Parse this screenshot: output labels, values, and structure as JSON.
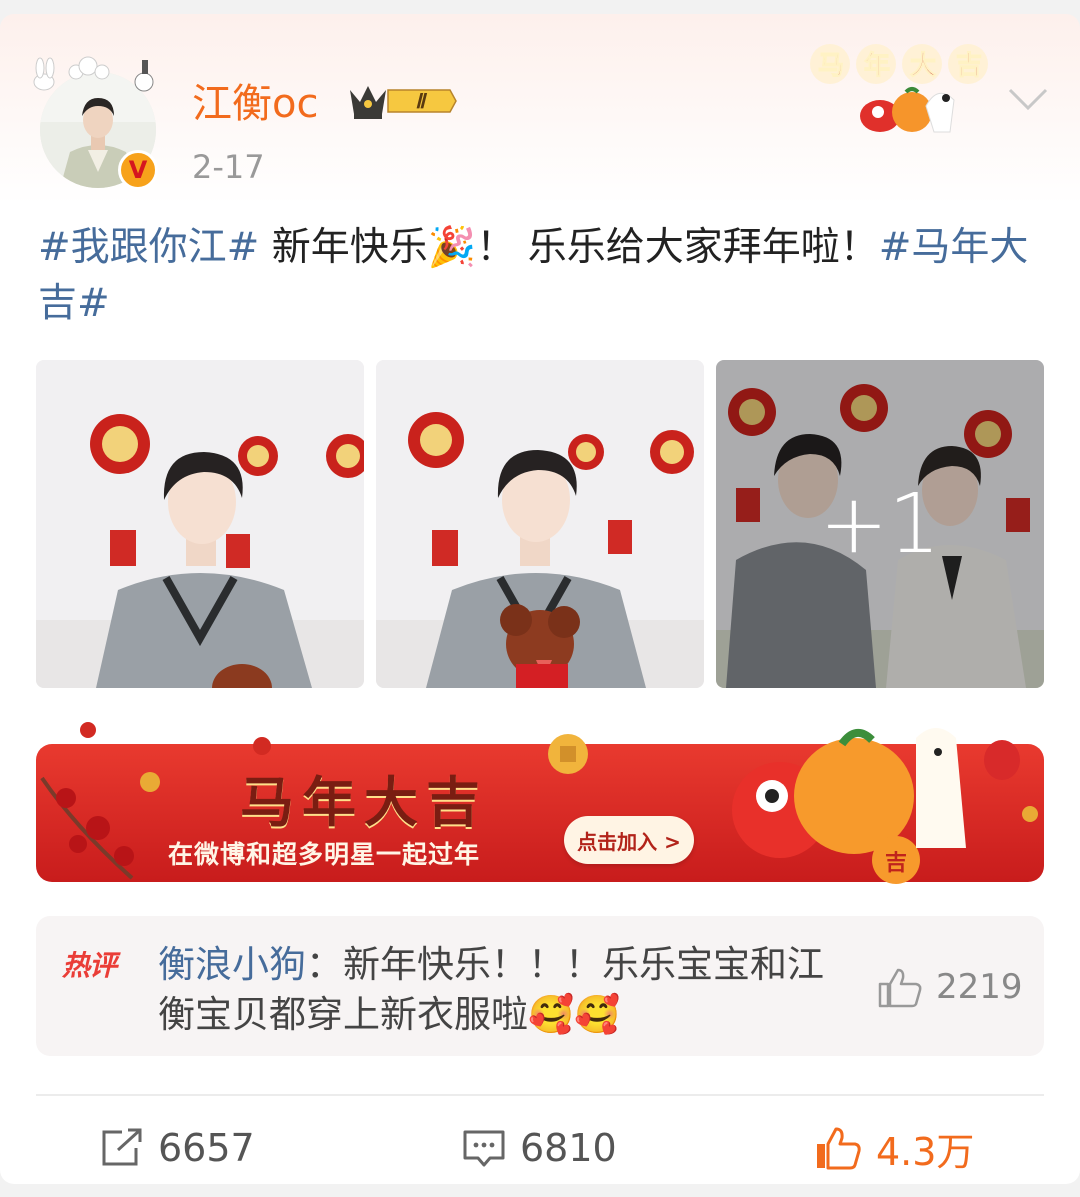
{
  "post": {
    "username": "江衡oc",
    "level_badge": "Ⅱ",
    "verify_mark": "V",
    "date": "2-17",
    "badge_text": "马年大吉",
    "text": {
      "topic1": "#我跟你江#",
      "body": " 新年快乐🎉！ 乐乐给大家拜年啦！",
      "topic2": "#马年大吉#"
    },
    "images": {
      "extra_count": "+1"
    }
  },
  "banner": {
    "title": "马年大吉",
    "subtitle": "在微博和超多明星一起过年",
    "button": "点击加入 >"
  },
  "hot_comment": {
    "tag": "热评",
    "user": "衡浪小狗",
    "separator": "：",
    "text": "新年快乐！！！乐乐宝宝和江衡宝贝都穿上新衣服啦🥰🥰",
    "likes": "2219"
  },
  "actions": {
    "reposts": "6657",
    "comments": "6810",
    "likes": "4.3万"
  },
  "colors": {
    "username": "#f26b1d",
    "topic": "#466c9b",
    "liked": "#f26b1d",
    "banner_red": "#d9252b"
  }
}
